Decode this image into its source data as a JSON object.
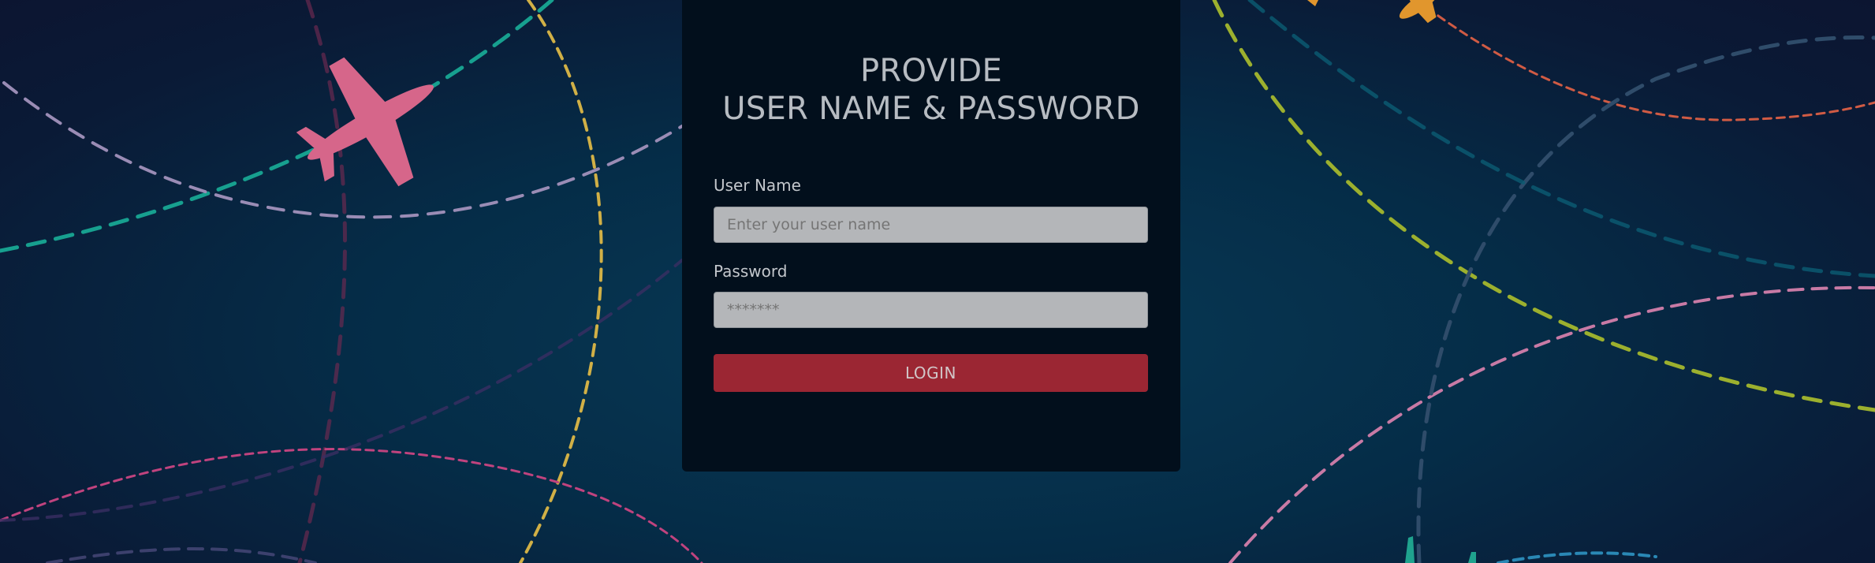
{
  "login": {
    "title_line1": "PROVIDE",
    "title_line2": "USER NAME & PASSWORD",
    "username_label": "User Name",
    "username_placeholder": "Enter your user name",
    "password_label": "Password",
    "password_placeholder": "*******",
    "login_button": "LOGIN"
  },
  "background": {
    "theme": "flight-paths-map",
    "icons": [
      "airplane-icon",
      "airplane-icon",
      "airplane-icon",
      "airplane-icon"
    ],
    "colors": {
      "pink_plane": "#d6668a",
      "orange_plane": "#e1962d",
      "teal_plane": "#1fa38e",
      "login_button": "#9b2633",
      "panel": "#020f1c"
    }
  }
}
